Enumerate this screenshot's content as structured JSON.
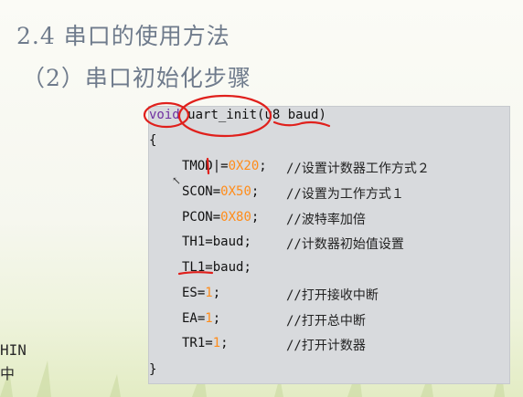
{
  "slide": {
    "title": "2.4 串口的使用方法",
    "subtitle": "（2）串口初始化步骤"
  },
  "code": {
    "sig_keyword": "void",
    "sig_func": "uart_init",
    "sig_paren_open": "(",
    "sig_param": "u8 baud",
    "sig_paren_close": ")",
    "open_brace": "{",
    "close_brace": "}",
    "lines": [
      {
        "stmt_name": "TMOD",
        "stmt_op": "|=",
        "stmt_value": "0X20",
        "stmt_end": ";",
        "comment": "//设置计数器工作方式２"
      },
      {
        "stmt_name": "SCON",
        "stmt_op": "=",
        "stmt_value": "0X50",
        "stmt_end": ";",
        "comment": "//设置为工作方式１"
      },
      {
        "stmt_name": "PCON",
        "stmt_op": "=",
        "stmt_value": "0X80",
        "stmt_end": ";",
        "comment": "//波特率加倍"
      },
      {
        "stmt_name": "TH1",
        "stmt_op": "=",
        "stmt_value": "baud",
        "stmt_end": ";",
        "comment": "//计数器初始值设置"
      },
      {
        "stmt_name": "TL1",
        "stmt_op": "=",
        "stmt_value": "baud",
        "stmt_end": ";",
        "comment": ""
      },
      {
        "stmt_name": "ES",
        "stmt_op": "=",
        "stmt_value": "1",
        "stmt_end": ";",
        "comment": "//打开接收中断"
      },
      {
        "stmt_name": "EA",
        "stmt_op": "=",
        "stmt_value": "1",
        "stmt_end": ";",
        "comment": "//打开总中断"
      },
      {
        "stmt_name": "TR1",
        "stmt_op": "=",
        "stmt_value": "1",
        "stmt_end": ";",
        "comment": "//打开计数器"
      }
    ]
  },
  "left_fragments": [
    "HIN",
    "中"
  ],
  "colors": {
    "keyword": "#7030a0",
    "number": "#ff8c1a",
    "title": "#6f7b8c",
    "annotation": "#e0201c"
  }
}
